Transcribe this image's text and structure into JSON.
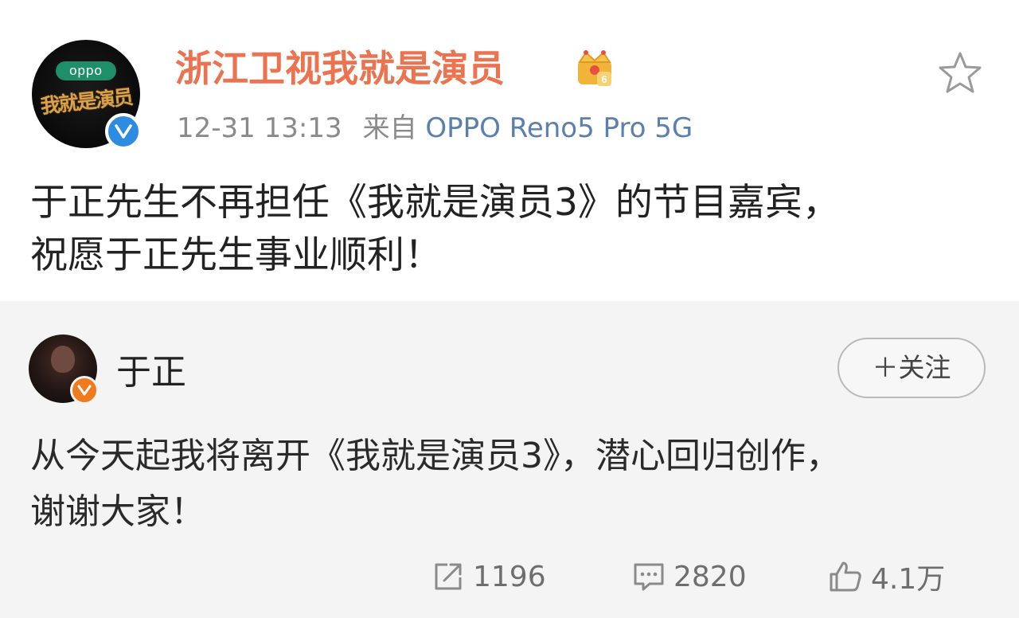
{
  "post": {
    "author": {
      "name": "浙江卫视我就是演员",
      "avatar_logo_text": "oppo",
      "avatar_show_text": "我就是演员",
      "verified_icon": "verified-blue-icon",
      "badge_icon": "crown-level-badge-icon",
      "badge_level": "6"
    },
    "time": "12-31 13:13",
    "source_prefix": "来自",
    "source_device": "OPPO Reno5 Pro 5G",
    "text_lines": [
      "于正先生不再担任《我就是演员3》的节目嘉宾，",
      "祝愿于正先生事业顺利！"
    ],
    "favorite_icon": "star-outline-icon"
  },
  "repost": {
    "author": {
      "name": "于正",
      "verified_icon": "verified-orange-icon"
    },
    "follow_label": "＋关注",
    "text_lines": [
      "从今天起我将离开《我就是演员3》，潜心回归创作，",
      "谢谢大家！"
    ],
    "stats": {
      "reposts": "1196",
      "comments": "2820",
      "likes": "4.1万"
    }
  },
  "colors": {
    "name_orange": "#eb7350",
    "device_blue": "#5b7fb0",
    "meta_gray": "#8a8a8a",
    "verified_blue": "#2d8be0",
    "verified_orange": "#f07a1e",
    "repost_bg": "#f4f4f4"
  }
}
